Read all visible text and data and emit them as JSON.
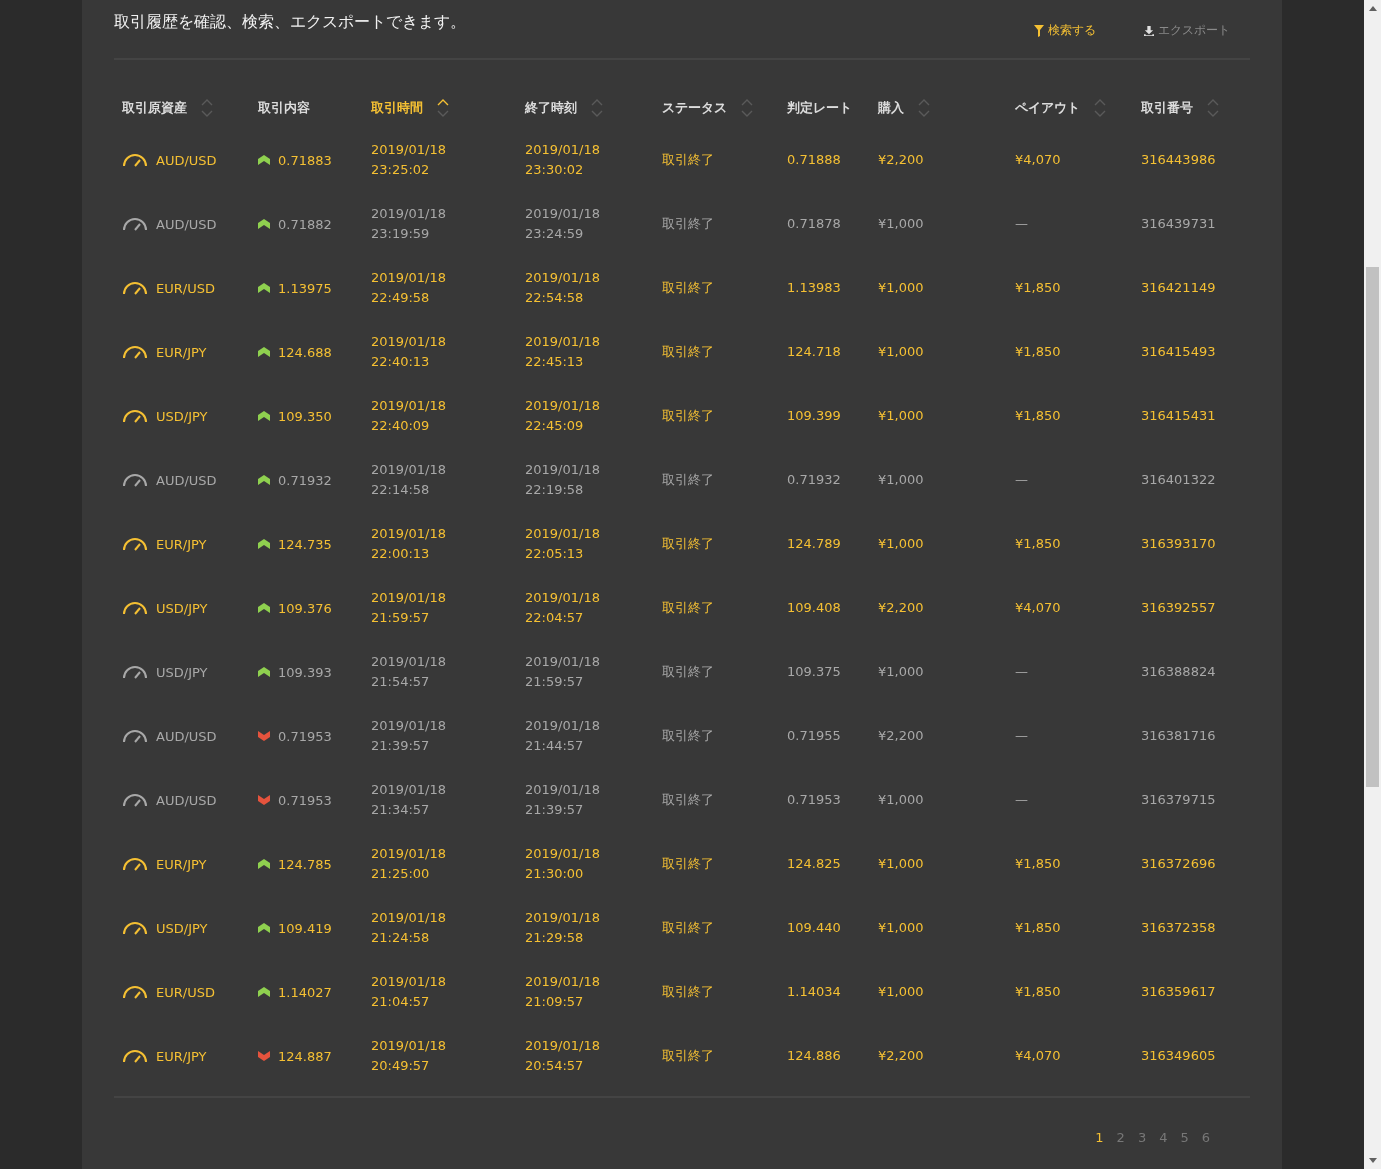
{
  "header": {
    "description": "取引履歴を確認、検索、エクスポートできます。",
    "actions": [
      {
        "kind": "filter",
        "label": "検索する",
        "highlighted": true
      },
      {
        "kind": "download",
        "label": "エクスポート",
        "highlighted": false
      }
    ]
  },
  "table": {
    "columns": [
      {
        "label": "取引原資産",
        "sortable": true,
        "selected": false
      },
      {
        "label": "取引内容",
        "sortable": false,
        "selected": false
      },
      {
        "label": "取引時間",
        "sortable": true,
        "selected": true
      },
      {
        "label": "終了時刻",
        "sortable": true,
        "selected": false
      },
      {
        "label": "ステータス",
        "sortable": true,
        "selected": false
      },
      {
        "label": "判定レート",
        "sortable": false,
        "selected": false
      },
      {
        "label": "購入",
        "sortable": true,
        "selected": false
      },
      {
        "label": "ペイアウト",
        "sortable": true,
        "selected": false
      },
      {
        "label": "取引番号",
        "sortable": true,
        "selected": false
      }
    ],
    "rows": [
      {
        "won": true,
        "asset": "AUD/USD",
        "kind": "up",
        "entry_rate": "0.71883",
        "start": "2019/01/18\n23:25:02",
        "end": "2019/01/18\n23:30:02",
        "status": "取引終了",
        "judge_rate": "0.71888",
        "purchase": "¥2,200",
        "payout": "¥4,070",
        "trade_no": "316443986"
      },
      {
        "won": false,
        "asset": "AUD/USD",
        "kind": "up",
        "entry_rate": "0.71882",
        "start": "2019/01/18\n23:19:59",
        "end": "2019/01/18\n23:24:59",
        "status": "取引終了",
        "judge_rate": "0.71878",
        "purchase": "¥1,000",
        "payout": "—",
        "trade_no": "316439731"
      },
      {
        "won": true,
        "asset": "EUR/USD",
        "kind": "up",
        "entry_rate": "1.13975",
        "start": "2019/01/18\n22:49:58",
        "end": "2019/01/18\n22:54:58",
        "status": "取引終了",
        "judge_rate": "1.13983",
        "purchase": "¥1,000",
        "payout": "¥1,850",
        "trade_no": "316421149"
      },
      {
        "won": true,
        "asset": "EUR/JPY",
        "kind": "up",
        "entry_rate": "124.688",
        "start": "2019/01/18\n22:40:13",
        "end": "2019/01/18\n22:45:13",
        "status": "取引終了",
        "judge_rate": "124.718",
        "purchase": "¥1,000",
        "payout": "¥1,850",
        "trade_no": "316415493"
      },
      {
        "won": true,
        "asset": "USD/JPY",
        "kind": "up",
        "entry_rate": "109.350",
        "start": "2019/01/18\n22:40:09",
        "end": "2019/01/18\n22:45:09",
        "status": "取引終了",
        "judge_rate": "109.399",
        "purchase": "¥1,000",
        "payout": "¥1,850",
        "trade_no": "316415431"
      },
      {
        "won": false,
        "asset": "AUD/USD",
        "kind": "up",
        "entry_rate": "0.71932",
        "start": "2019/01/18\n22:14:58",
        "end": "2019/01/18\n22:19:58",
        "status": "取引終了",
        "judge_rate": "0.71932",
        "purchase": "¥1,000",
        "payout": "—",
        "trade_no": "316401322"
      },
      {
        "won": true,
        "asset": "EUR/JPY",
        "kind": "up",
        "entry_rate": "124.735",
        "start": "2019/01/18\n22:00:13",
        "end": "2019/01/18\n22:05:13",
        "status": "取引終了",
        "judge_rate": "124.789",
        "purchase": "¥1,000",
        "payout": "¥1,850",
        "trade_no": "316393170"
      },
      {
        "won": true,
        "asset": "USD/JPY",
        "kind": "up",
        "entry_rate": "109.376",
        "start": "2019/01/18\n21:59:57",
        "end": "2019/01/18\n22:04:57",
        "status": "取引終了",
        "judge_rate": "109.408",
        "purchase": "¥2,200",
        "payout": "¥4,070",
        "trade_no": "316392557"
      },
      {
        "won": false,
        "asset": "USD/JPY",
        "kind": "up",
        "entry_rate": "109.393",
        "start": "2019/01/18\n21:54:57",
        "end": "2019/01/18\n21:59:57",
        "status": "取引終了",
        "judge_rate": "109.375",
        "purchase": "¥1,000",
        "payout": "—",
        "trade_no": "316388824"
      },
      {
        "won": false,
        "asset": "AUD/USD",
        "kind": "down",
        "entry_rate": "0.71953",
        "start": "2019/01/18\n21:39:57",
        "end": "2019/01/18\n21:44:57",
        "status": "取引終了",
        "judge_rate": "0.71955",
        "purchase": "¥2,200",
        "payout": "—",
        "trade_no": "316381716"
      },
      {
        "won": false,
        "asset": "AUD/USD",
        "kind": "down",
        "entry_rate": "0.71953",
        "start": "2019/01/18\n21:34:57",
        "end": "2019/01/18\n21:39:57",
        "status": "取引終了",
        "judge_rate": "0.71953",
        "purchase": "¥1,000",
        "payout": "—",
        "trade_no": "316379715"
      },
      {
        "won": true,
        "asset": "EUR/JPY",
        "kind": "up",
        "entry_rate": "124.785",
        "start": "2019/01/18\n21:25:00",
        "end": "2019/01/18\n21:30:00",
        "status": "取引終了",
        "judge_rate": "124.825",
        "purchase": "¥1,000",
        "payout": "¥1,850",
        "trade_no": "316372696"
      },
      {
        "won": true,
        "asset": "USD/JPY",
        "kind": "up",
        "entry_rate": "109.419",
        "start": "2019/01/18\n21:24:58",
        "end": "2019/01/18\n21:29:58",
        "status": "取引終了",
        "judge_rate": "109.440",
        "purchase": "¥1,000",
        "payout": "¥1,850",
        "trade_no": "316372358"
      },
      {
        "won": true,
        "asset": "EUR/USD",
        "kind": "up",
        "entry_rate": "1.14027",
        "start": "2019/01/18\n21:04:57",
        "end": "2019/01/18\n21:09:57",
        "status": "取引終了",
        "judge_rate": "1.14034",
        "purchase": "¥1,000",
        "payout": "¥1,850",
        "trade_no": "316359617"
      },
      {
        "won": true,
        "asset": "EUR/JPY",
        "kind": "down",
        "entry_rate": "124.887",
        "start": "2019/01/18\n20:49:57",
        "end": "2019/01/18\n20:54:57",
        "status": "取引終了",
        "judge_rate": "124.886",
        "purchase": "¥2,200",
        "payout": "¥4,070",
        "trade_no": "316349605"
      }
    ]
  },
  "pagination": [
    {
      "label": "1",
      "selected": true
    },
    {
      "label": "2",
      "selected": false
    },
    {
      "label": "3",
      "selected": false
    },
    {
      "label": "4",
      "selected": false
    },
    {
      "label": "5",
      "selected": false
    },
    {
      "label": "6",
      "selected": false
    }
  ]
}
